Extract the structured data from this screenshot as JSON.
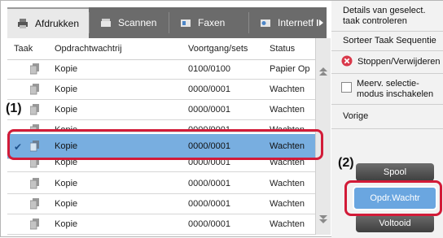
{
  "tabs": [
    {
      "label": "Afdrukken",
      "icon": "printer-icon",
      "active": true
    },
    {
      "label": "Scannen",
      "icon": "scanner-icon",
      "active": false
    },
    {
      "label": "Faxen",
      "icon": "fax-icon",
      "active": false
    },
    {
      "label": "Internetfax",
      "icon": "internet-fax-icon",
      "active": false
    }
  ],
  "tab_more_icon": "chevron-right-icon",
  "table": {
    "headers": [
      "Taak",
      "Opdrachtwachtrij",
      "Voortgang/sets",
      "Status"
    ],
    "rows": [
      {
        "name": "Kopie",
        "progress": "0100/0100",
        "status": "Papier Op",
        "selected": false
      },
      {
        "name": "Kopie",
        "progress": "0000/0001",
        "status": "Wachten",
        "selected": false
      },
      {
        "name": "Kopie",
        "progress": "0000/0001",
        "status": "Wachten",
        "selected": false
      },
      {
        "name": "Kopie",
        "progress": "0000/0001",
        "status": "Wachten",
        "selected": false
      },
      {
        "name": "Kopie",
        "progress": "0000/0001",
        "status": "Wachten",
        "selected": true
      },
      {
        "name": "Kopie",
        "progress": "0000/0001",
        "status": "Wachten",
        "selected": false
      },
      {
        "name": "Kopie",
        "progress": "0000/0001",
        "status": "Wachten",
        "selected": false
      },
      {
        "name": "Kopie",
        "progress": "0000/0001",
        "status": "Wachten",
        "selected": false
      },
      {
        "name": "Kopie",
        "progress": "0000/0001",
        "status": "Wachten",
        "selected": false
      }
    ]
  },
  "right_panel": {
    "details": "Details van geselect. taak controleren",
    "sort": "Sorteer Taak Sequentie",
    "stop_delete": "Stoppen/Verwijderen",
    "multi_select": "Meerv. selectie-modus inschakelen",
    "previous": "Vorige",
    "spool": "Spool",
    "job_queue": "Opdr.Wachtr",
    "completed": "Voltooid"
  },
  "callouts": {
    "one": "(1)",
    "two": "(2)"
  },
  "colors": {
    "selected_row": "#78aee0",
    "callout": "#d21b38",
    "primary_button": "#6aa6e0",
    "stop_icon": "#d9384a"
  }
}
